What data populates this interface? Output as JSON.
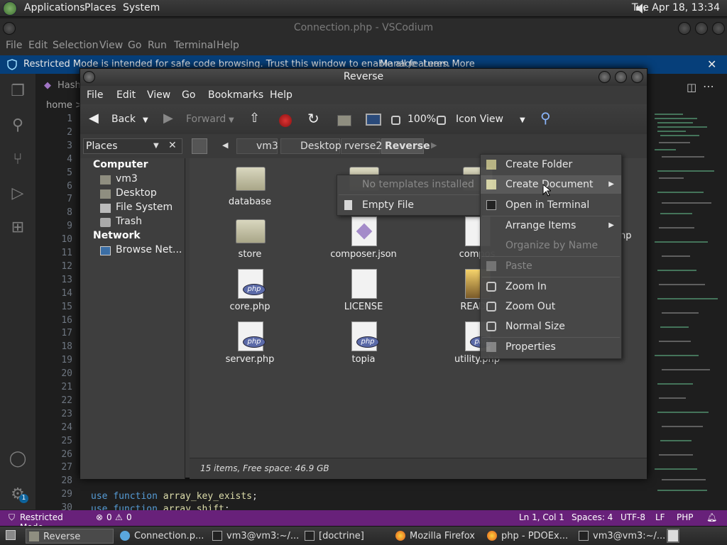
{
  "top_panel": {
    "menus": [
      "Applications",
      "Places",
      "System"
    ],
    "clock": "Tue Apr 18, 13:34"
  },
  "vscode": {
    "title": "Connection.php - VSCodium",
    "menu": [
      "File",
      "Edit",
      "Selection",
      "View",
      "Go",
      "Run",
      "Terminal",
      "Help"
    ],
    "banner": {
      "text": "Restricted Mode is intended for safe code browsing. Trust this window to enable all features.",
      "manage": "Manage",
      "learn_more": "Learn More"
    },
    "tab_label": "Hash",
    "breadcrumb": "home >",
    "line_numbers": [
      "1",
      "2",
      "3",
      "4",
      "5",
      "6",
      "7",
      "8",
      "9",
      "10",
      "11",
      "12",
      "13",
      "14",
      "15",
      "16",
      "17",
      "18",
      "19",
      "20",
      "21",
      "22",
      "23",
      "24",
      "25",
      "26",
      "27",
      "28",
      "29",
      "30"
    ],
    "code_line_29": {
      "kw1": "use",
      "kw2": "function",
      "name": "array_key_exists",
      "end": ";"
    },
    "code_line_30": {
      "kw1": "use",
      "kw2": "function",
      "name": "array_shift",
      "end": ";"
    },
    "account_badge": "1",
    "status": {
      "restricted": "Restricted Mode",
      "errors": "0",
      "warnings": "0",
      "position": "Ln 1, Col 1",
      "spaces": "Spaces: 4",
      "encoding": "UTF-8",
      "eol": "LF",
      "language": "PHP"
    }
  },
  "nautilus": {
    "title": "Reverse",
    "menu": [
      "File",
      "Edit",
      "View",
      "Go",
      "Bookmarks",
      "Help"
    ],
    "toolbar": {
      "back": "Back",
      "forward": "Forward",
      "zoom": "100%",
      "view": "Icon View"
    },
    "places_label": "Places",
    "path": [
      "vm3",
      "Desktop",
      "rverse2",
      "Reverse"
    ],
    "sidebar": {
      "computer_header": "Computer",
      "computer_items": [
        "vm3",
        "Desktop",
        "File System",
        "Trash"
      ],
      "network_header": "Network",
      "network_items": [
        "Browse Net..."
      ]
    },
    "files": [
      {
        "name": "database",
        "type": "folder"
      },
      {
        "name": "",
        "type": "folder"
      },
      {
        "name": "",
        "type": "folder"
      },
      {
        "name": "store",
        "type": "folder"
      },
      {
        "name": "composer.json",
        "type": "json"
      },
      {
        "name": "compos",
        "type": "doc"
      },
      {
        "name": "core.php",
        "type": "php"
      },
      {
        "name": "LICENSE",
        "type": "doc"
      },
      {
        "name": "READM",
        "type": "image"
      },
      {
        "name": "server.php",
        "type": "php"
      },
      {
        "name": "topia",
        "type": "php"
      },
      {
        "name": "utility.php",
        "type": "php"
      }
    ],
    "hidden_label_fragment": "np",
    "status": "15 items, Free space: 46.9 GB"
  },
  "submenu": {
    "disabled": "No templates installed",
    "empty_file": "Empty File"
  },
  "context_menu": {
    "create_folder": "Create Folder",
    "create_document": "Create Document",
    "open_terminal": "Open in Terminal",
    "arrange_items": "Arrange Items",
    "organize": "Organize by Name",
    "paste": "Paste",
    "zoom_in": "Zoom In",
    "zoom_out": "Zoom Out",
    "normal_size": "Normal Size",
    "properties": "Properties"
  },
  "taskbar": [
    {
      "label": "Reverse",
      "active": true
    },
    {
      "label": "Connection.p...",
      "active": false
    },
    {
      "label": "vm3@vm3:~/...",
      "active": false
    },
    {
      "label": "[doctrine]",
      "active": false
    },
    {
      "label": "Mozilla Firefox",
      "active": false
    },
    {
      "label": "php - PDOEx...",
      "active": false
    },
    {
      "label": "vm3@vm3:~/...",
      "active": false
    }
  ]
}
